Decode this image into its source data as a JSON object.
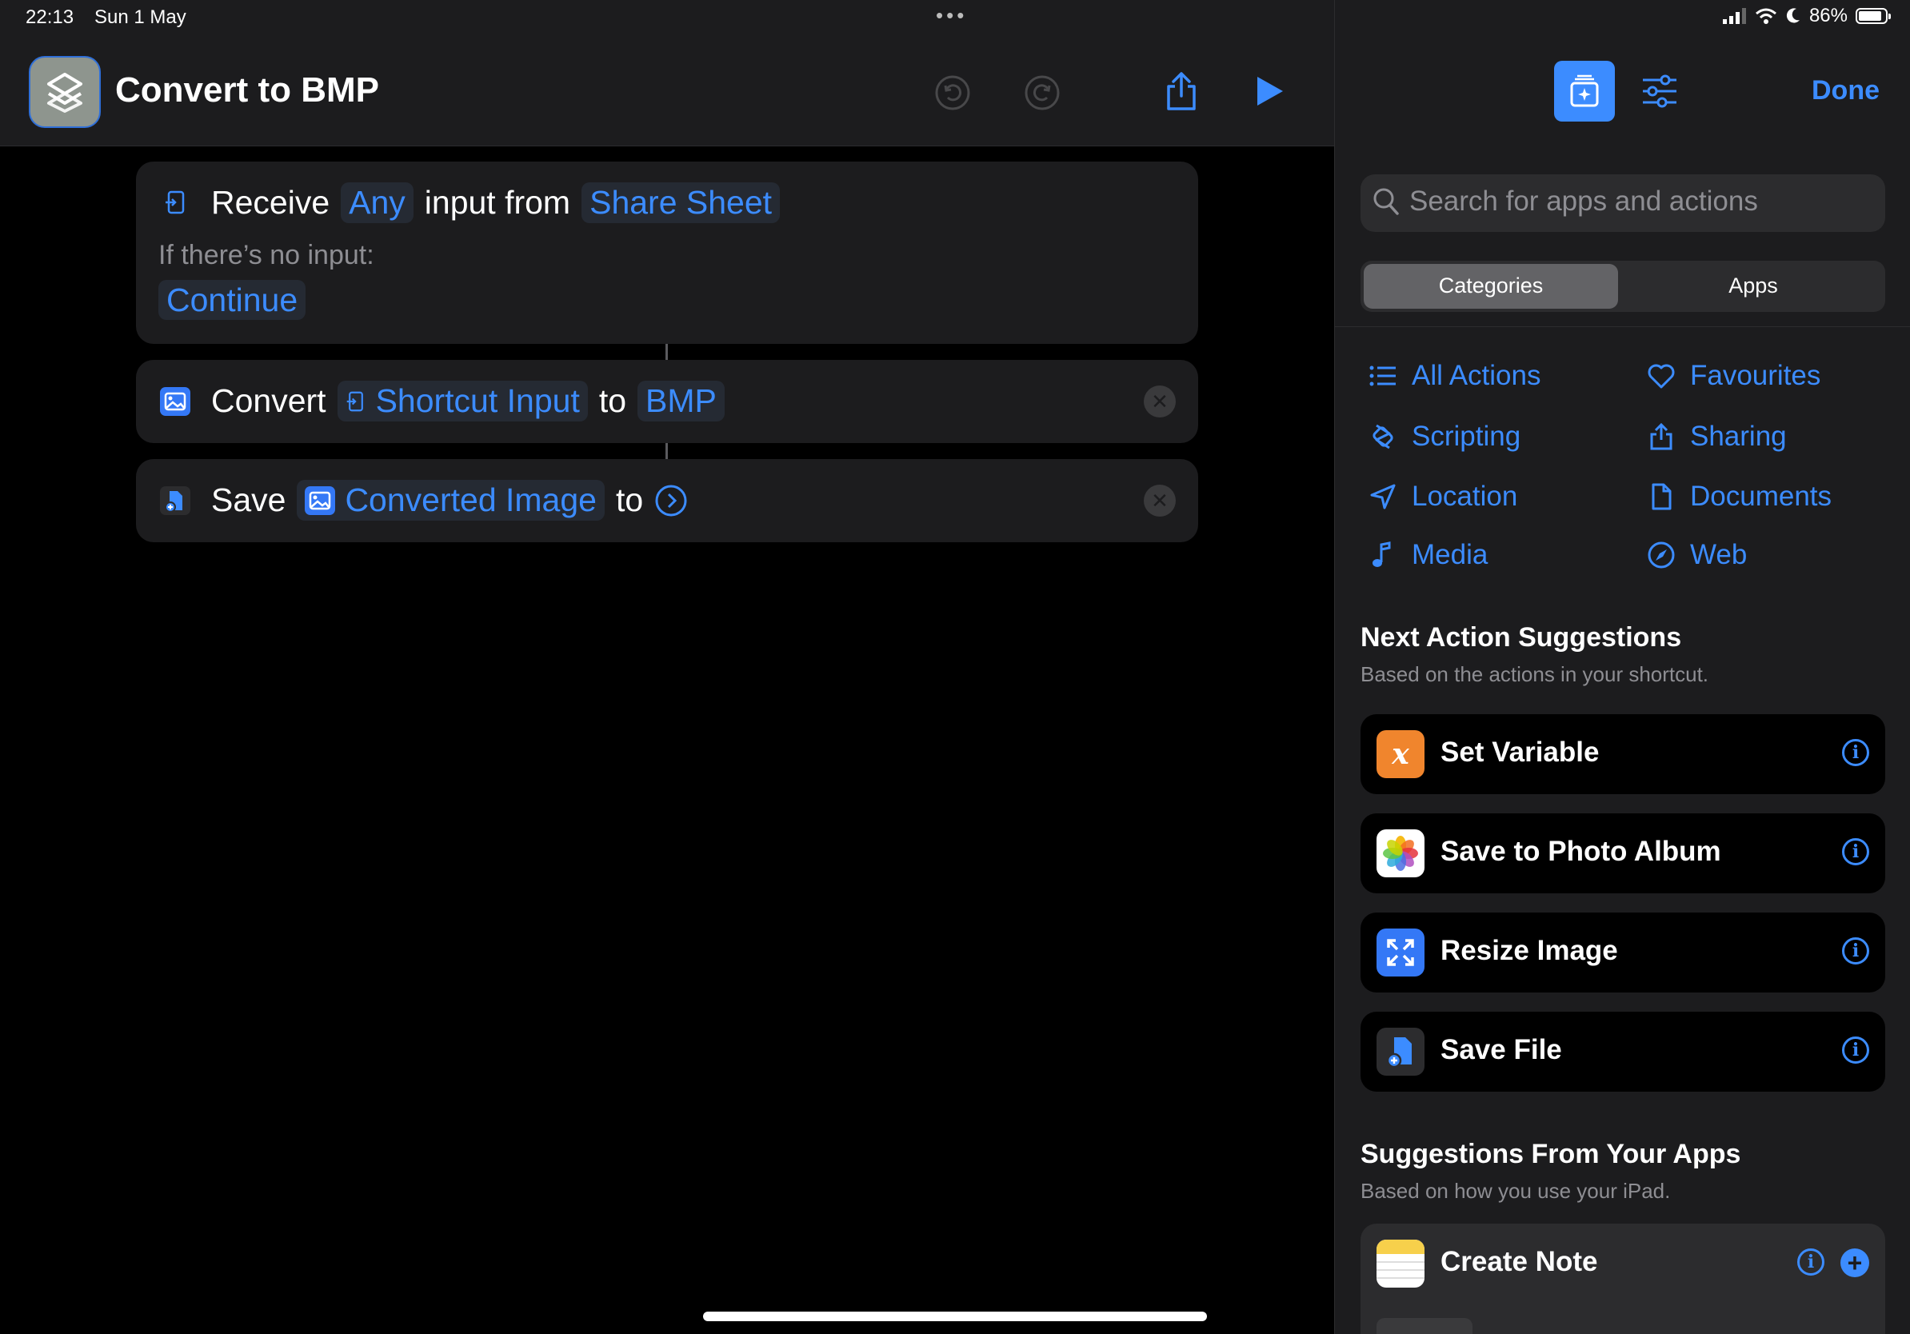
{
  "status_bar": {
    "time": "22:13",
    "date": "Sun 1 May",
    "battery": "86%",
    "battery_level": 0.86
  },
  "header": {
    "title": "Convert to BMP",
    "done_label": "Done"
  },
  "actions": {
    "receive": {
      "verb": "Receive",
      "type": "Any",
      "mid": "input from",
      "source": "Share Sheet",
      "no_input_label": "If there’s no input:",
      "no_input_value": "Continue"
    },
    "convert": {
      "verb": "Convert",
      "input": "Shortcut Input",
      "to": "to",
      "format": "BMP"
    },
    "save": {
      "verb": "Save",
      "input": "Converted Image",
      "to": "to"
    }
  },
  "panel": {
    "search_placeholder": "Search for apps and actions",
    "segments": [
      "Categories",
      "Apps"
    ],
    "categories": [
      "All Actions",
      "Favourites",
      "Scripting",
      "Sharing",
      "Location",
      "Documents",
      "Media",
      "Web"
    ],
    "next_title": "Next Action Suggestions",
    "next_sub": "Based on the actions in your shortcut.",
    "suggestions": [
      "Set Variable",
      "Save to Photo Album",
      "Resize Image",
      "Save File"
    ],
    "apps_title": "Suggestions From Your Apps",
    "apps_sub": "Based on how you use your iPad.",
    "app_suggestions": [
      "Create Note"
    ]
  },
  "colors": {
    "accent": "#3c8cff",
    "card": "#1c1c1e",
    "background": "#000000"
  }
}
